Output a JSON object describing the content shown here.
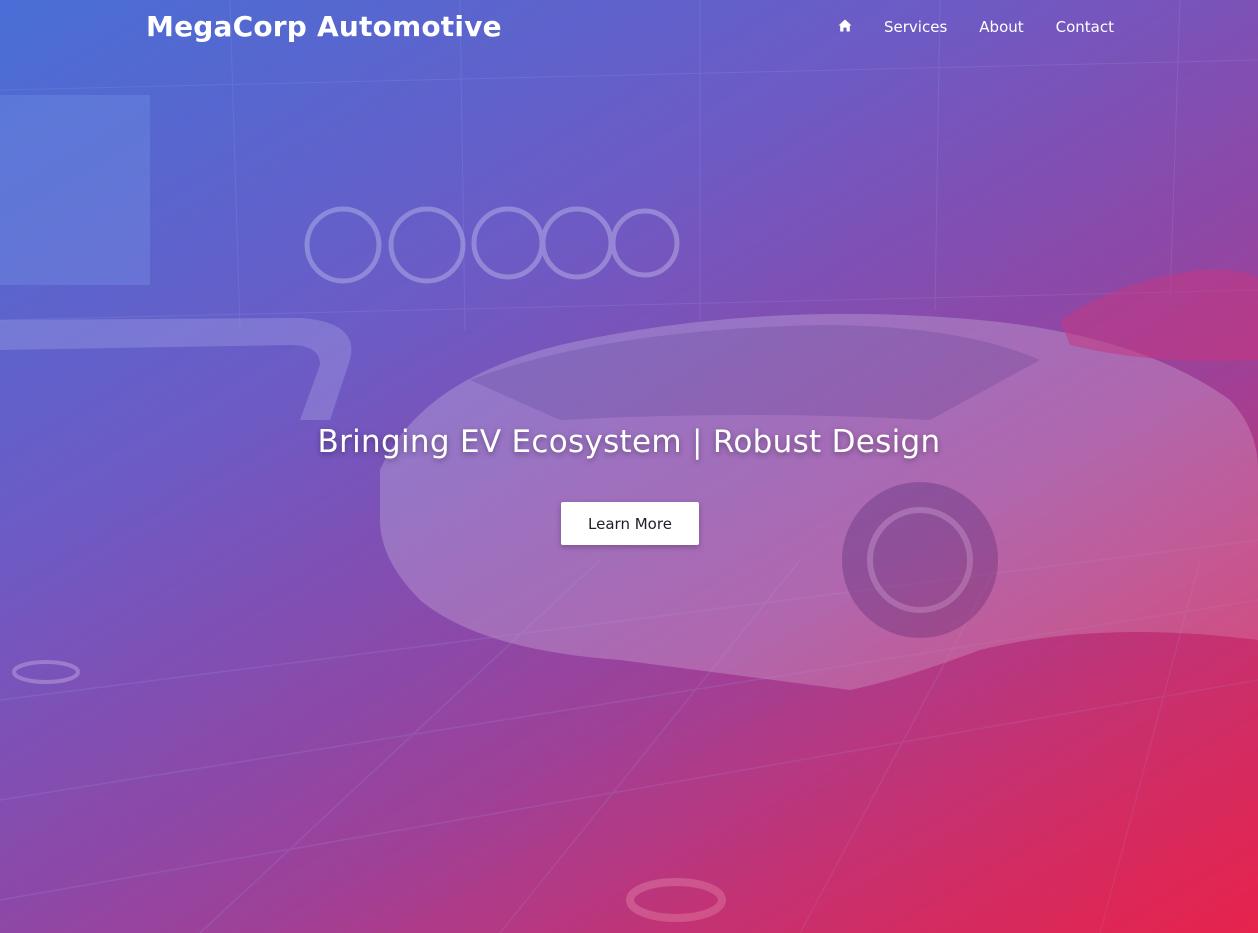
{
  "brand": {
    "title": "MegaCorp Automotive"
  },
  "nav": {
    "home_icon": "home-icon",
    "items": [
      {
        "label": "Services"
      },
      {
        "label": "About"
      },
      {
        "label": "Contact"
      }
    ]
  },
  "hero": {
    "headline": "Bringing EV Ecosystem | Robust Design",
    "cta_label": "Learn More",
    "background": "showroom-car-photo"
  },
  "colors": {
    "gradient_start": "#4a6fd6",
    "gradient_end": "#e2234f",
    "text": "#ffffff",
    "button_bg": "#ffffff"
  }
}
